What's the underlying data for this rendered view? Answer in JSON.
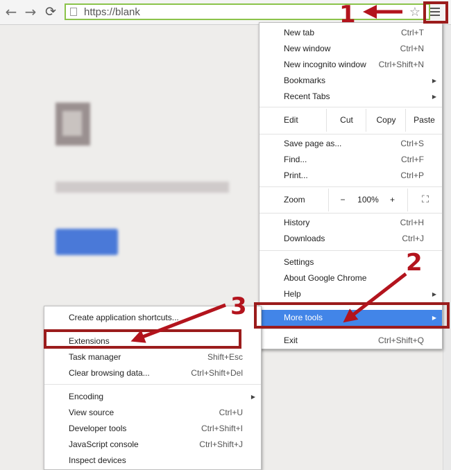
{
  "toolbar": {
    "back_icon": "←",
    "forward_icon": "→",
    "reload_icon": "⟳",
    "url": "https://blank",
    "star_icon": "☆"
  },
  "main_menu": {
    "items": [
      {
        "label": "New tab",
        "shortcut": "Ctrl+T"
      },
      {
        "label": "New window",
        "shortcut": "Ctrl+N"
      },
      {
        "label": "New incognito window",
        "shortcut": "Ctrl+Shift+N"
      },
      {
        "label": "Bookmarks",
        "submenu": true
      },
      {
        "label": "Recent Tabs",
        "submenu": true
      }
    ],
    "edit": {
      "label": "Edit",
      "cut": "Cut",
      "copy": "Copy",
      "paste": "Paste"
    },
    "file_items": [
      {
        "label": "Save page as...",
        "shortcut": "Ctrl+S"
      },
      {
        "label": "Find...",
        "shortcut": "Ctrl+F"
      },
      {
        "label": "Print...",
        "shortcut": "Ctrl+P"
      }
    ],
    "zoom": {
      "label": "Zoom",
      "minus": "−",
      "value": "100%",
      "plus": "+",
      "fullscreen": "⛶"
    },
    "history_items": [
      {
        "label": "History",
        "shortcut": "Ctrl+H"
      },
      {
        "label": "Downloads",
        "shortcut": "Ctrl+J"
      }
    ],
    "settings_items": [
      {
        "label": "Settings"
      },
      {
        "label": "About Google Chrome"
      },
      {
        "label": "Help",
        "submenu": true
      }
    ],
    "more_tools": {
      "label": "More tools",
      "submenu": true
    },
    "exit": {
      "label": "Exit",
      "shortcut": "Ctrl+Shift+Q"
    }
  },
  "sub_menu": {
    "items": [
      {
        "label": "Create application shortcuts..."
      },
      {
        "label": "Extensions"
      },
      {
        "label": "Task manager",
        "shortcut": "Shift+Esc"
      },
      {
        "label": "Clear browsing data...",
        "shortcut": "Ctrl+Shift+Del"
      }
    ],
    "items2": [
      {
        "label": "Encoding",
        "submenu": true
      },
      {
        "label": "View source",
        "shortcut": "Ctrl+U"
      },
      {
        "label": "Developer tools",
        "shortcut": "Ctrl+Shift+I"
      },
      {
        "label": "JavaScript console",
        "shortcut": "Ctrl+Shift+J"
      },
      {
        "label": "Inspect devices"
      }
    ]
  },
  "annotations": {
    "step1": "1",
    "step2": "2",
    "step3": "3",
    "color": "#b3141d"
  }
}
